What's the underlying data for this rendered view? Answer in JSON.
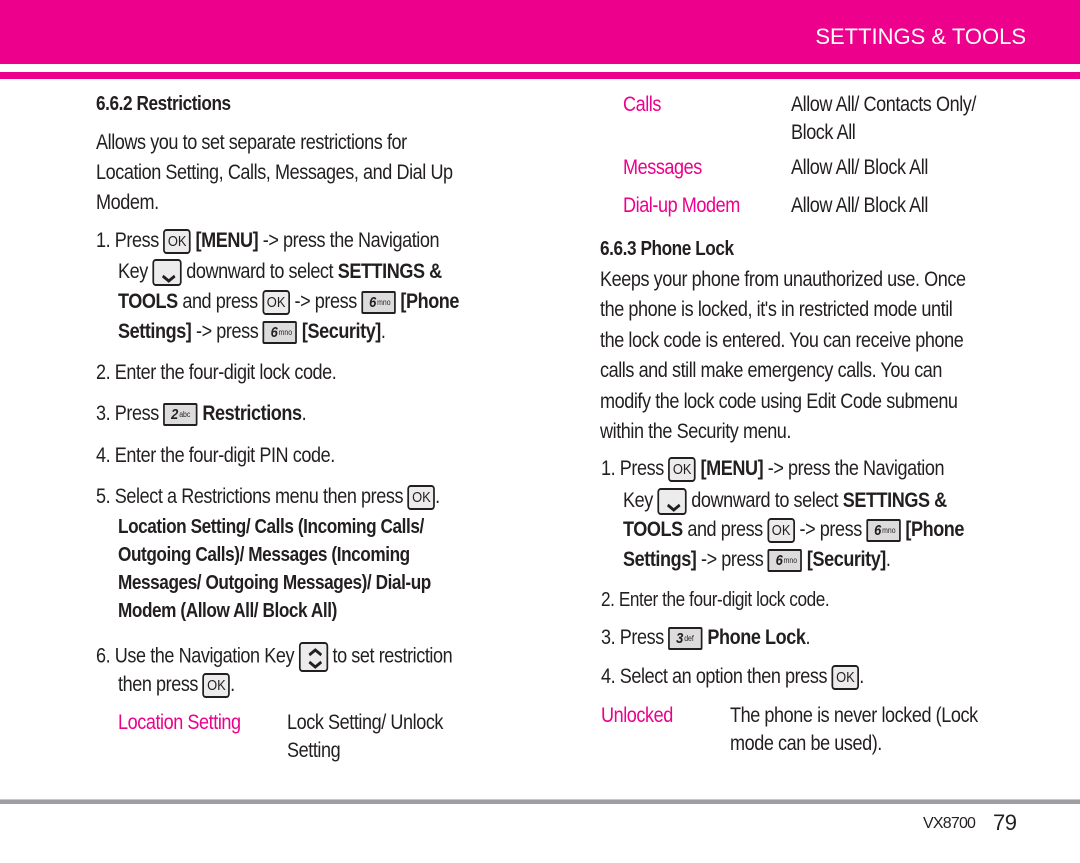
{
  "header": {
    "section_title": "SETTINGS & TOOLS",
    "accent_color": "#ec008c"
  },
  "left": {
    "heading": "6.6.2 Restrictions",
    "intro": [
      "Allows you to set separate restrictions for",
      "Location Setting, Calls, Messages, and Dial Up",
      "Modem."
    ],
    "steps": {
      "s1": {
        "num": "1.",
        "press": "Press",
        "ok_key": "OK",
        "menu": "[MENU]",
        "nav_text": "-> press the Navigation",
        "key_word": "Key",
        "downward": "downward to select",
        "settings_amp": "SETTINGS &",
        "tools": "TOOLS",
        "and_press": "and press",
        "arrow_press": "-> press",
        "key6_digit": "6",
        "key6_letters": "mno",
        "phone": "[Phone",
        "settings_close": "Settings]",
        "arrow_press2": "-> press",
        "security": "[Security]",
        "period": "."
      },
      "s2": {
        "num": "2.",
        "text": "Enter the four-digit lock code."
      },
      "s3": {
        "num": "3.",
        "press": "Press",
        "key_digit": "2",
        "key_letters": "abc",
        "target": "Restrictions",
        "period": "."
      },
      "s4": {
        "num": "4.",
        "text": "Enter the four-digit PIN code."
      },
      "s5": {
        "num": "5.",
        "text": "Select a Restrictions menu then press",
        "ok_key": "OK",
        "period": "."
      },
      "s5_options": [
        "Location Setting/ Calls (Incoming Calls/",
        "Outgoing Calls)/ Messages (Incoming",
        "Messages/ Outgoing Messages)/ Dial-up",
        "Modem (Allow All/ Block All)"
      ],
      "s6": {
        "num": "6.",
        "text_a": "Use the Navigation Key",
        "text_b": "to set restriction",
        "text_c": "then press",
        "ok_key": "OK",
        "period": "."
      }
    },
    "option_rows": [
      {
        "label": "Location Setting",
        "value_lines": [
          "Lock Setting/ Unlock",
          "Setting"
        ]
      }
    ]
  },
  "right": {
    "option_rows": [
      {
        "label": "Calls",
        "value_lines": [
          "Allow All/ Contacts Only/",
          "Block All"
        ]
      },
      {
        "label": "Messages",
        "value_lines": [
          "Allow All/ Block All"
        ]
      },
      {
        "label": "Dial-up Modem",
        "value_lines": [
          "Allow All/ Block All"
        ]
      }
    ],
    "heading": "6.6.3 Phone Lock",
    "intro": [
      "Keeps your phone from unauthorized use. Once",
      "the phone is locked, it's in restricted mode until",
      "the lock code is entered. You can receive phone",
      "calls and still make emergency calls. You can",
      "modify the lock code using Edit Code submenu",
      "within the Security menu."
    ],
    "steps": {
      "s1": {
        "num": "1.",
        "press": "Press",
        "ok_key": "OK",
        "menu": "[MENU]",
        "nav_text": "-> press the Navigation",
        "key_word": "Key",
        "downward": "downward to select",
        "settings_amp": "SETTINGS &",
        "tools": "TOOLS",
        "and_press": "and press",
        "arrow_press": "-> press",
        "key6_digit": "6",
        "key6_letters": "mno",
        "phone": "[Phone",
        "settings_close": "Settings]",
        "arrow_press2": "-> press",
        "security": "[Security]",
        "period": "."
      },
      "s2": {
        "num": "2.",
        "text": "Enter the four-digit lock code."
      },
      "s3": {
        "num": "3.",
        "press": "Press",
        "key_digit": "3",
        "key_letters": "def",
        "target": "Phone Lock",
        "period": "."
      },
      "s4": {
        "num": "4.",
        "text": "Select an option then press",
        "ok_key": "OK",
        "period": "."
      }
    },
    "lock_options": [
      {
        "label": "Unlocked",
        "value_lines": [
          "The phone is never locked (Lock",
          "mode can be used)."
        ]
      }
    ]
  },
  "footer": {
    "model": "VX8700",
    "page_number": "79"
  }
}
